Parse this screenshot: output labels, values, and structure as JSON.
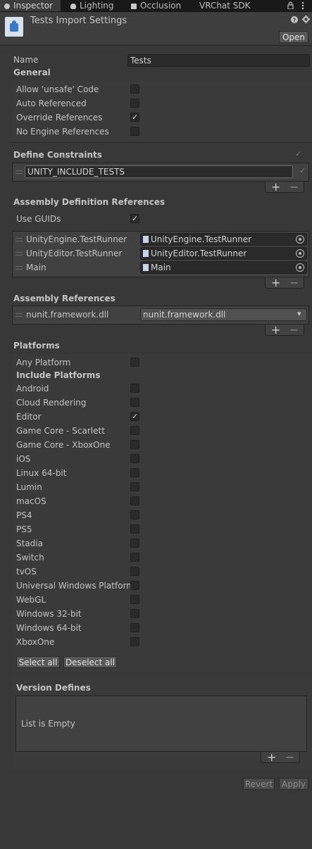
{
  "tabs": [
    {
      "label": "Inspector",
      "active": true
    },
    {
      "label": "Lighting"
    },
    {
      "label": "Occlusion"
    },
    {
      "label": "VRChat SDK"
    }
  ],
  "header": {
    "title": "Tests Import Settings",
    "open_label": "Open"
  },
  "name": {
    "label": "Name",
    "value": "Tests"
  },
  "general": {
    "heading": "General",
    "items": [
      {
        "label": "Allow 'unsafe' Code",
        "checked": false
      },
      {
        "label": "Auto Referenced",
        "checked": false
      },
      {
        "label": "Override References",
        "checked": true
      },
      {
        "label": "No Engine References",
        "checked": false
      }
    ]
  },
  "define_constraints": {
    "heading": "Define Constraints",
    "items": [
      "UNITY_INCLUDE_TESTS"
    ]
  },
  "assembly_definition_references": {
    "heading": "Assembly Definition References",
    "use_guids": {
      "label": "Use GUIDs",
      "checked": true
    },
    "items": [
      {
        "name": "UnityEngine.TestRunner",
        "value": "UnityEngine.TestRunner"
      },
      {
        "name": "UnityEditor.TestRunner",
        "value": "UnityEditor.TestRunner"
      },
      {
        "name": "Main",
        "value": "Main"
      }
    ]
  },
  "assembly_references": {
    "heading": "Assembly References",
    "items": [
      {
        "name": "nunit.framework.dll",
        "value": "nunit.framework.dll"
      }
    ]
  },
  "platforms": {
    "heading": "Platforms",
    "any_platform": {
      "label": "Any Platform",
      "checked": false
    },
    "include_heading": "Include Platforms",
    "items": [
      {
        "label": "Android",
        "checked": false
      },
      {
        "label": "Cloud Rendering",
        "checked": false
      },
      {
        "label": "Editor",
        "checked": true
      },
      {
        "label": "Game Core - Scarlett",
        "checked": false
      },
      {
        "label": "Game Core - XboxOne",
        "checked": false
      },
      {
        "label": "iOS",
        "checked": false
      },
      {
        "label": "Linux 64-bit",
        "checked": false
      },
      {
        "label": "Lumin",
        "checked": false
      },
      {
        "label": "macOS",
        "checked": false
      },
      {
        "label": "PS4",
        "checked": false
      },
      {
        "label": "PS5",
        "checked": false
      },
      {
        "label": "Stadia",
        "checked": false
      },
      {
        "label": "Switch",
        "checked": false
      },
      {
        "label": "tvOS",
        "checked": false
      },
      {
        "label": "Universal Windows Platform",
        "checked": false
      },
      {
        "label": "WebGL",
        "checked": false
      },
      {
        "label": "Windows 32-bit",
        "checked": false
      },
      {
        "label": "Windows 64-bit",
        "checked": false
      },
      {
        "label": "XboxOne",
        "checked": false
      }
    ],
    "select_all": "Select all",
    "deselect_all": "Deselect all"
  },
  "version_defines": {
    "heading": "Version Defines",
    "empty_text": "List is Empty"
  },
  "footer": {
    "revert": "Revert",
    "apply": "Apply"
  },
  "symbols": {
    "plus": "+",
    "minus": "−",
    "check": "✓",
    "dropdown": "▾"
  }
}
